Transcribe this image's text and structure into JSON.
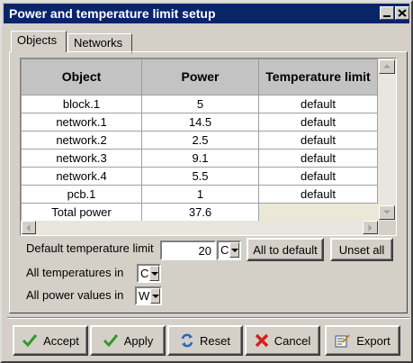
{
  "window": {
    "title": "Power and temperature limit setup"
  },
  "tabs": [
    {
      "label": "Objects"
    },
    {
      "label": "Networks"
    }
  ],
  "table": {
    "headers": {
      "object": "Object",
      "power": "Power",
      "temp": "Temperature limit"
    },
    "rows": [
      {
        "object": "block.1",
        "power": "5",
        "temp": "default"
      },
      {
        "object": "network.1",
        "power": "14.5",
        "temp": "default"
      },
      {
        "object": "network.2",
        "power": "2.5",
        "temp": "default"
      },
      {
        "object": "network.3",
        "power": "9.1",
        "temp": "default"
      },
      {
        "object": "network.4",
        "power": "5.5",
        "temp": "default"
      },
      {
        "object": "pcb.1",
        "power": "1",
        "temp": "default"
      },
      {
        "object": "Total power",
        "power": "37.6",
        "temp": ""
      }
    ]
  },
  "settings": {
    "default_temp_label": "Default temperature limit",
    "default_temp_value": "20",
    "default_temp_unit": "C",
    "all_to_default": "All to default",
    "unset_all": "Unset all",
    "all_temps_label": "All temperatures in",
    "all_temps_unit": "C",
    "all_power_label": "All power values in",
    "all_power_unit": "W"
  },
  "buttons": {
    "accept": "Accept",
    "apply": "Apply",
    "reset": "Reset",
    "cancel": "Cancel",
    "export": "Export"
  },
  "colors": {
    "titlebar": "#0a246a",
    "check_green": "#2e9a2e",
    "cancel_red": "#d42020",
    "reset_blue": "#2a64c8"
  }
}
